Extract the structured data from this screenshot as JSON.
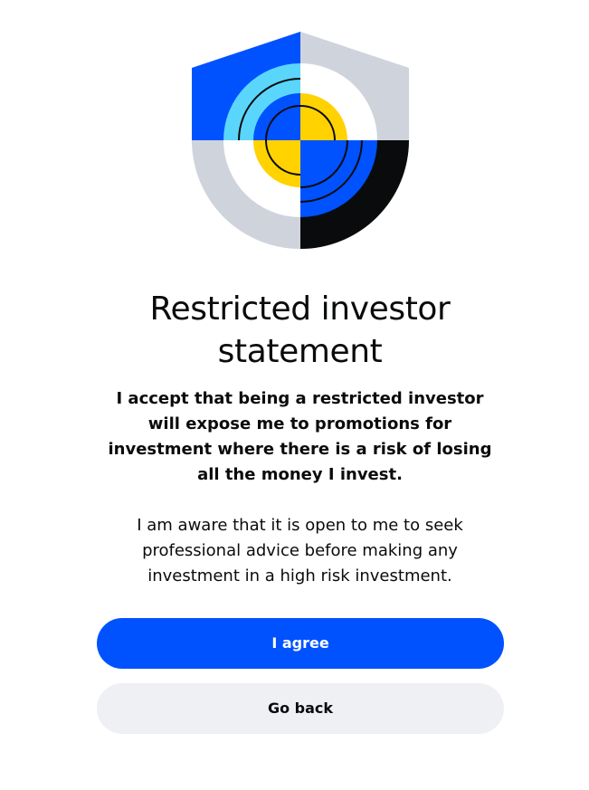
{
  "illustration": {
    "icon": "shield-icon",
    "colors": {
      "blue": "#0052ff",
      "light_blue": "#5ad6fd",
      "gray": "#cfd3dc",
      "yellow": "#ffd200",
      "black": "#0a0b0d",
      "white": "#ffffff"
    }
  },
  "dialog": {
    "title": "Restricted investor statement",
    "bold_statement": "I accept that being a restricted investor will expose me to promotions for investment where there is a risk of losing all the money I invest.",
    "regular_statement": "I am aware that it is open to me to seek professional advice before making any investment in a high risk investment."
  },
  "actions": {
    "agree_label": "I agree",
    "go_back_label": "Go back"
  },
  "colors": {
    "primary": "#0052ff",
    "secondary_bg": "#eef0f3",
    "text": "#0a0b0d"
  }
}
